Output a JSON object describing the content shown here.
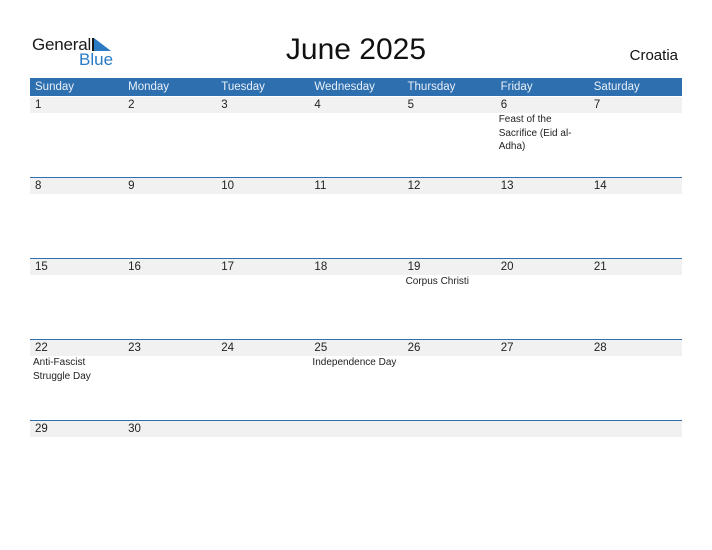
{
  "brand": {
    "word1": "General",
    "word2": "Blue",
    "color": "#2a7bc4"
  },
  "title": "June 2025",
  "country": "Croatia",
  "colors": {
    "header_bg": "#2e6fb0",
    "date_band": "#f1f1f1"
  },
  "weekdays": [
    "Sunday",
    "Monday",
    "Tuesday",
    "Wednesday",
    "Thursday",
    "Friday",
    "Saturday"
  ],
  "weeks": [
    [
      {
        "d": "1",
        "e": ""
      },
      {
        "d": "2",
        "e": ""
      },
      {
        "d": "3",
        "e": ""
      },
      {
        "d": "4",
        "e": ""
      },
      {
        "d": "5",
        "e": ""
      },
      {
        "d": "6",
        "e": "Feast of the Sacrifice (Eid al-Adha)"
      },
      {
        "d": "7",
        "e": ""
      }
    ],
    [
      {
        "d": "8",
        "e": ""
      },
      {
        "d": "9",
        "e": ""
      },
      {
        "d": "10",
        "e": ""
      },
      {
        "d": "11",
        "e": ""
      },
      {
        "d": "12",
        "e": ""
      },
      {
        "d": "13",
        "e": ""
      },
      {
        "d": "14",
        "e": ""
      }
    ],
    [
      {
        "d": "15",
        "e": ""
      },
      {
        "d": "16",
        "e": ""
      },
      {
        "d": "17",
        "e": ""
      },
      {
        "d": "18",
        "e": ""
      },
      {
        "d": "19",
        "e": "Corpus Christi"
      },
      {
        "d": "20",
        "e": ""
      },
      {
        "d": "21",
        "e": ""
      }
    ],
    [
      {
        "d": "22",
        "e": "Anti-Fascist Struggle Day"
      },
      {
        "d": "23",
        "e": ""
      },
      {
        "d": "24",
        "e": ""
      },
      {
        "d": "25",
        "e": "Independence Day"
      },
      {
        "d": "26",
        "e": ""
      },
      {
        "d": "27",
        "e": ""
      },
      {
        "d": "28",
        "e": ""
      }
    ],
    [
      {
        "d": "29",
        "e": ""
      },
      {
        "d": "30",
        "e": ""
      },
      {
        "d": "",
        "e": ""
      },
      {
        "d": "",
        "e": ""
      },
      {
        "d": "",
        "e": ""
      },
      {
        "d": "",
        "e": ""
      },
      {
        "d": "",
        "e": ""
      }
    ]
  ]
}
